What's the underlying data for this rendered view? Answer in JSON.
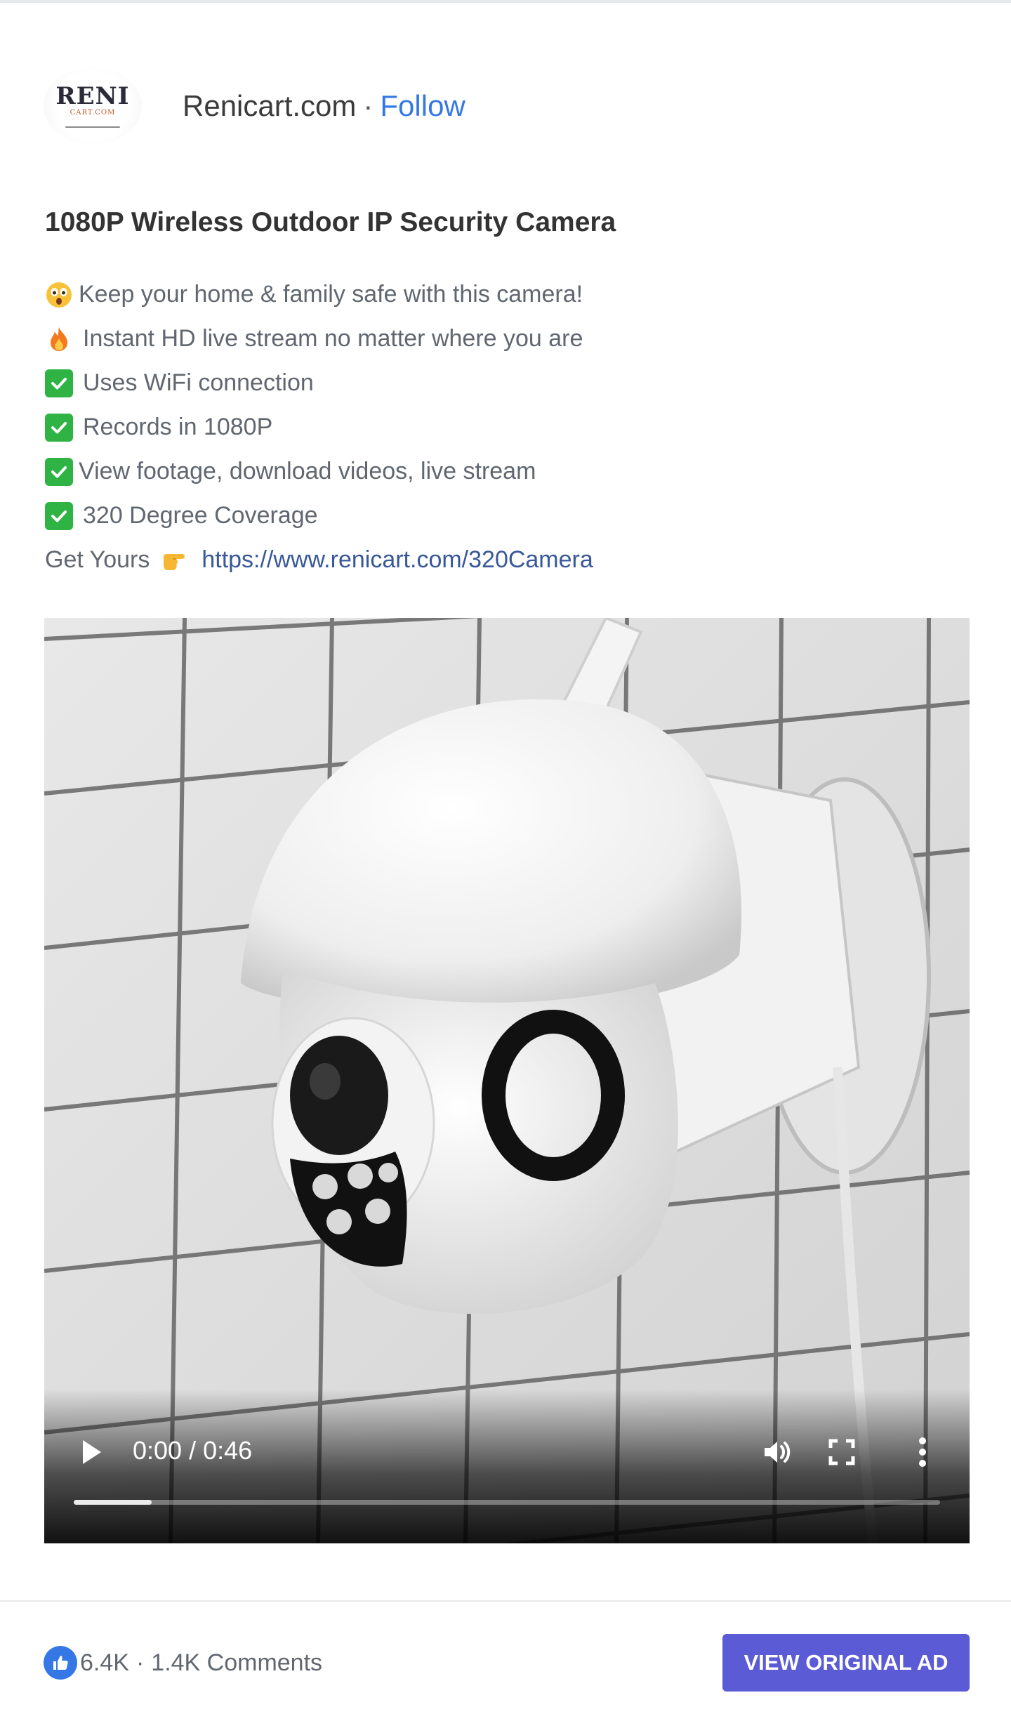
{
  "advertiser": {
    "logo_text": "RENI",
    "logo_subtext": "CART.COM",
    "name": "Renicart.com",
    "separator": "·",
    "follow_label": "Follow"
  },
  "ad": {
    "title": "1080P Wireless Outdoor IP Security Camera",
    "lines": [
      {
        "icon": "astonished-face-emoji",
        "text": "Keep your home & family safe with this camera!"
      },
      {
        "icon": "fire-emoji",
        "text": "Instant HD live stream no matter where you are"
      },
      {
        "icon": "check-mark-emoji",
        "text": "Uses WiFi connection"
      },
      {
        "icon": "check-mark-emoji",
        "text": "Records in 1080P"
      },
      {
        "icon": "check-mark-emoji",
        "text": "View footage, download videos, live stream"
      },
      {
        "icon": "check-mark-emoji",
        "text": "320 Degree Coverage"
      }
    ],
    "cta_line": {
      "prefix": "Get Yours",
      "icon": "pointing-hand-emoji",
      "url": "https://www.renicart.com/320Camera"
    }
  },
  "video": {
    "poster_description_icon": "security-camera-image",
    "time_display": "0:00 / 0:46",
    "progress_fraction": 0.09,
    "controls": {
      "play_icon": "play-icon",
      "volume_icon": "volume-icon",
      "fullscreen_icon": "fullscreen-icon",
      "more_icon": "more-vertical-icon"
    }
  },
  "engagement": {
    "likes": "6.4K",
    "separator": "·",
    "comments": "1.4K Comments"
  },
  "view_button_label": "VIEW ORIGINAL AD",
  "colors": {
    "link": "#385898",
    "follow": "#3578e5",
    "button": "#5b5bd6",
    "check": "#2fb344",
    "like": "#3578e5"
  }
}
